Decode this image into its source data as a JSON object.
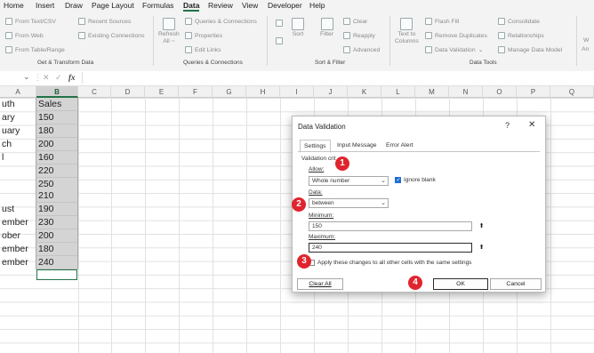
{
  "menu": [
    "Home",
    "Insert",
    "Draw",
    "Page Layout",
    "Formulas",
    "Data",
    "Review",
    "View",
    "Developer",
    "Help"
  ],
  "menu_active": "Data",
  "ribbon": {
    "get_transform": {
      "from_text_csv": "From Text/CSV",
      "from_web": "From Web",
      "from_table_range": "From Table/Range",
      "recent_sources": "Recent Sources",
      "existing_connections": "Existing Connections",
      "label": "Get & Transform Data"
    },
    "queries": {
      "refresh": "Refresh",
      "refresh_all": "All ~",
      "queries_connections": "Queries & Connections",
      "properties": "Properties",
      "edit_links": "Edit Links",
      "label": "Queries & Connections"
    },
    "sort_filter": {
      "sort": "Sort",
      "filter": "Filter",
      "clear": "Clear",
      "reapply": "Reapply",
      "advanced": "Advanced",
      "label": "Sort & Filter"
    },
    "data_tools": {
      "text_to": "Text to",
      "columns": "Columns",
      "flash_fill": "Flash Fill",
      "remove_duplicates": "Remove Duplicates",
      "data_validation": "Data Validation",
      "consolidate": "Consolidate",
      "relationships": "Relationships",
      "manage_data_model": "Manage Data Model",
      "label": "Data Tools"
    },
    "edge_a": "W",
    "edge_b": "An"
  },
  "formula_bar": {
    "fx": "fx",
    "cancel": "✕",
    "enter": "✓"
  },
  "columns": [
    "A",
    "B",
    "C",
    "D",
    "E",
    "F",
    "G",
    "H",
    "I",
    "J",
    "K",
    "L",
    "M",
    "N",
    "O",
    "P",
    "Q"
  ],
  "col_a_values": [
    "uth",
    "ary",
    "uary",
    "ch",
    "l",
    "",
    "",
    "",
    "ust",
    "ember",
    "ober",
    "ember",
    "ember"
  ],
  "col_b_values": [
    "Sales",
    "150",
    "180",
    "200",
    "160",
    "220",
    "250",
    "210",
    "190",
    "230",
    "200",
    "180",
    "240"
  ],
  "dialog": {
    "title": "Data Validation",
    "help": "?",
    "close": "✕",
    "tabs": [
      "Settings",
      "Input Message",
      "Error Alert"
    ],
    "validation_criteria": "Validation crit",
    "allow_label": "Allow:",
    "allow_value": "Whole number",
    "ignore_blank": "Ignore blank",
    "data_label": "Data:",
    "data_value": "between",
    "minimum_label": "Minimum:",
    "minimum_value": "150",
    "maximum_label": "Maximum:",
    "maximum_value": "240",
    "apply_text": "Apply these changes to all other cells with the same settings",
    "clear_all": "Clear All",
    "ok": "OK",
    "cancel": "Cancel"
  },
  "badges": [
    "1",
    "2",
    "3",
    "4"
  ],
  "colors": {
    "accent": "#217346",
    "badge": "#e0242e",
    "checkbox": "#1f6fd1"
  }
}
